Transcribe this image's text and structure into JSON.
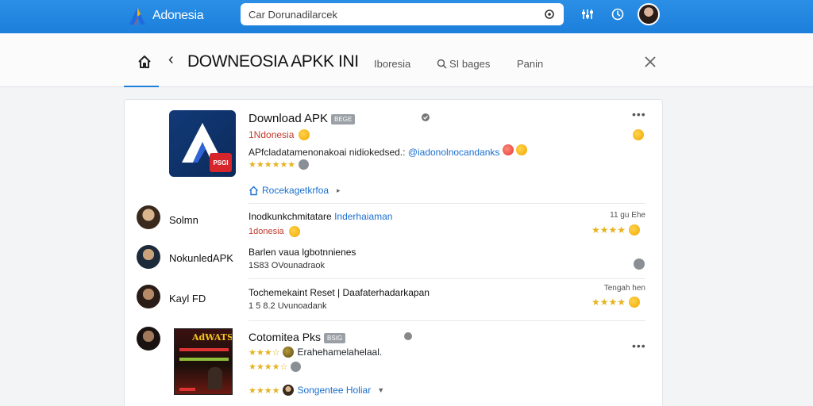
{
  "topbar": {
    "brand_name": "Adonesia",
    "search_value": "Car Dorunadilarcek",
    "colors": {
      "bar": "#1c7fdb",
      "logo_a": "#1f6be0",
      "logo_b": "#e8423b",
      "logo_c": "#f5b400"
    }
  },
  "subheader": {
    "page_title": "DOWNEOSIA APKK INI",
    "tab_1": "Iboresia",
    "tab_2": "SI bages",
    "tab_3": "Panin"
  },
  "hero": {
    "title": "Download APK",
    "tag": "BEGE",
    "subtitle": "1Ndonesia",
    "desc": "APfcladatamenonakoai nidiokedsed.:",
    "desc_link": "@iadonolnocandanks",
    "link": "Rocekagetkrfoa",
    "badge": "PSGI"
  },
  "reviews": [
    {
      "name": "Solmn",
      "title": "Inodkunkchmitatare",
      "title_link": "Inderhaiaman",
      "meta": "1donesia",
      "date": "11 gu Ehe",
      "stars": "★★★★"
    },
    {
      "name": "NokunledAPK",
      "title": "Barlen vaua lgbotnnienes",
      "meta": "1S83 OVounadraok",
      "date": "",
      "stars": ""
    },
    {
      "name": "Kayl FD",
      "title": "Tochemekaint Reset | Daafaterhadarkapan",
      "meta": "1 5 8.2 Uvunoadank",
      "date": "Tengah hen",
      "stars": "★★★★"
    },
    {
      "name": "",
      "title": "Cotomitea Pks",
      "tag": "BSIG",
      "line2": "Erahehamelahelaal.",
      "line3": "",
      "line4": "Songentee Holiar",
      "stars_a": "★★★☆",
      "stars_b": "★★★★☆",
      "stars_c": "★★★★"
    }
  ],
  "poster": {
    "title": "AdWATS"
  }
}
